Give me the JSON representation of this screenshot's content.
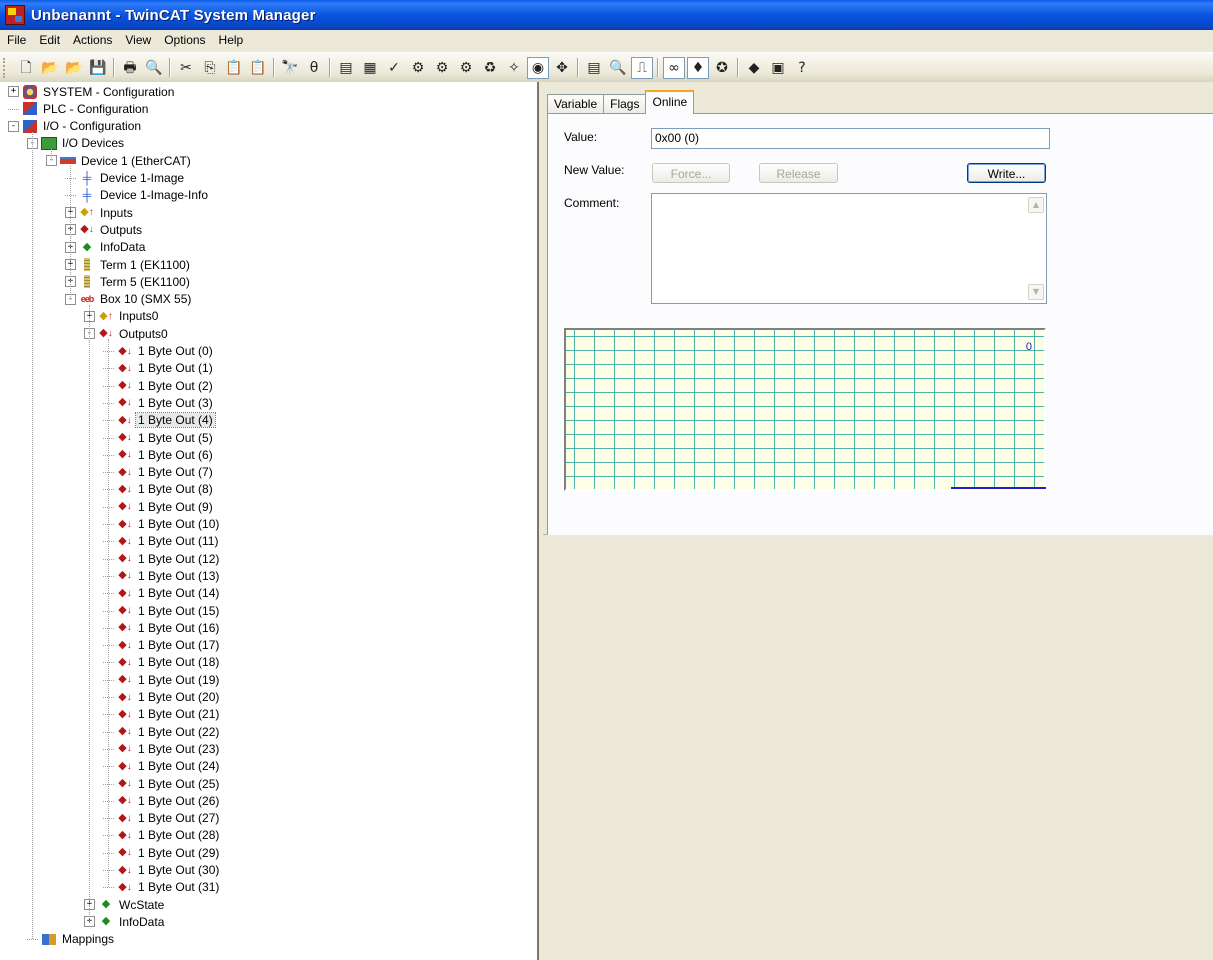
{
  "window": {
    "title": "Unbenannt - TwinCAT System Manager"
  },
  "menu": [
    "File",
    "Edit",
    "Actions",
    "View",
    "Options",
    "Help"
  ],
  "toolbar_icons": [
    {
      "name": "new-icon",
      "glyph": "🗋"
    },
    {
      "name": "open-icon",
      "glyph": "📂"
    },
    {
      "name": "open-from-target-icon",
      "glyph": "📂"
    },
    {
      "name": "save-icon",
      "glyph": "💾"
    },
    {
      "sep": true
    },
    {
      "name": "print-icon",
      "glyph": "🖶"
    },
    {
      "name": "print-preview-icon",
      "glyph": "🔍"
    },
    {
      "sep": true
    },
    {
      "name": "cut-icon",
      "glyph": "✂"
    },
    {
      "name": "copy-icon",
      "glyph": "⎘"
    },
    {
      "name": "paste-icon",
      "glyph": "📋"
    },
    {
      "name": "paste-with-links-icon",
      "glyph": "📋"
    },
    {
      "sep": true
    },
    {
      "name": "find-icon",
      "glyph": "🔭"
    },
    {
      "name": "find-next-icon",
      "glyph": "θ"
    },
    {
      "sep": true
    },
    {
      "name": "generate-mappings-icon",
      "glyph": "▤"
    },
    {
      "name": "activate-configuration-icon",
      "glyph": "▦"
    },
    {
      "name": "check-configuration-icon",
      "glyph": "✓"
    },
    {
      "name": "set-run-mode-icon",
      "glyph": "⚙"
    },
    {
      "name": "set-config-mode-icon",
      "glyph": "⚙"
    },
    {
      "name": "restart-icon",
      "glyph": "⚙"
    },
    {
      "name": "scan-devices-icon",
      "glyph": "♻"
    },
    {
      "name": "free-run-icon",
      "glyph": "✧"
    },
    {
      "name": "toggle-online-icon",
      "glyph": "◉",
      "pressed": true
    },
    {
      "name": "show-subitems-icon",
      "glyph": "✥"
    },
    {
      "sep": true
    },
    {
      "name": "show-online-data-icon",
      "glyph": "▤"
    },
    {
      "name": "zoom-icon",
      "glyph": "🔍"
    },
    {
      "name": "online-graph-icon",
      "glyph": "⎍",
      "pressed": true
    },
    {
      "sep": true
    },
    {
      "name": "watch-icon",
      "glyph": "∞",
      "pressed": true
    },
    {
      "name": "force-icon",
      "glyph": "♦",
      "pressed": true
    },
    {
      "name": "target-icon",
      "glyph": "✪"
    },
    {
      "sep": true
    },
    {
      "name": "help-book-icon",
      "glyph": "◆"
    },
    {
      "name": "context-help-icon",
      "glyph": "▣"
    },
    {
      "name": "help-icon",
      "glyph": "?"
    }
  ],
  "tree": {
    "system": "SYSTEM - Configuration",
    "plc": "PLC - Configuration",
    "io": "I/O - Configuration",
    "io_devices": "I/O Devices",
    "device1": "Device 1 (EtherCAT)",
    "device1_image": "Device 1-Image",
    "device1_image_info": "Device 1-Image-Info",
    "inputs": "Inputs",
    "outputs": "Outputs",
    "infodata": "InfoData",
    "term1": "Term 1 (EK1100)",
    "term5": "Term 5 (EK1100)",
    "box10": "Box 10 (SMX 55)",
    "inputs0": "Inputs0",
    "outputs0": "Outputs0",
    "byte_outs": [
      "1 Byte Out (0)",
      "1 Byte Out (1)",
      "1 Byte Out (2)",
      "1 Byte Out (3)",
      "1 Byte Out (4)",
      "1 Byte Out (5)",
      "1 Byte Out (6)",
      "1 Byte Out (7)",
      "1 Byte Out (8)",
      "1 Byte Out (9)",
      "1 Byte Out (10)",
      "1 Byte Out (11)",
      "1 Byte Out (12)",
      "1 Byte Out (13)",
      "1 Byte Out (14)",
      "1 Byte Out (15)",
      "1 Byte Out (16)",
      "1 Byte Out (17)",
      "1 Byte Out (18)",
      "1 Byte Out (19)",
      "1 Byte Out (20)",
      "1 Byte Out (21)",
      "1 Byte Out (22)",
      "1 Byte Out (23)",
      "1 Byte Out (24)",
      "1 Byte Out (25)",
      "1 Byte Out (26)",
      "1 Byte Out (27)",
      "1 Byte Out (28)",
      "1 Byte Out (29)",
      "1 Byte Out (30)",
      "1 Byte Out (31)"
    ],
    "selected_byte_out": "1 Byte Out (4)",
    "wcstate": "WcState",
    "infodata2": "InfoData",
    "mappings": "Mappings"
  },
  "tabs": [
    "Variable",
    "Flags",
    "Online"
  ],
  "active_tab": "Online",
  "online": {
    "value_label": "Value:",
    "value": "0x00 (0)",
    "new_value_label": "New Value:",
    "force_button": "Force...",
    "release_button": "Release",
    "write_button": "Write...",
    "comment_label": "Comment:",
    "comment": "",
    "graph_value_label": "0"
  },
  "colors": {
    "title_bar": "#0a54e0",
    "graph_background": "#fefee6",
    "graph_grid": "#4fb3a8",
    "graph_trace": "#2020c8",
    "active_tab_highlight": "#f6a621"
  }
}
